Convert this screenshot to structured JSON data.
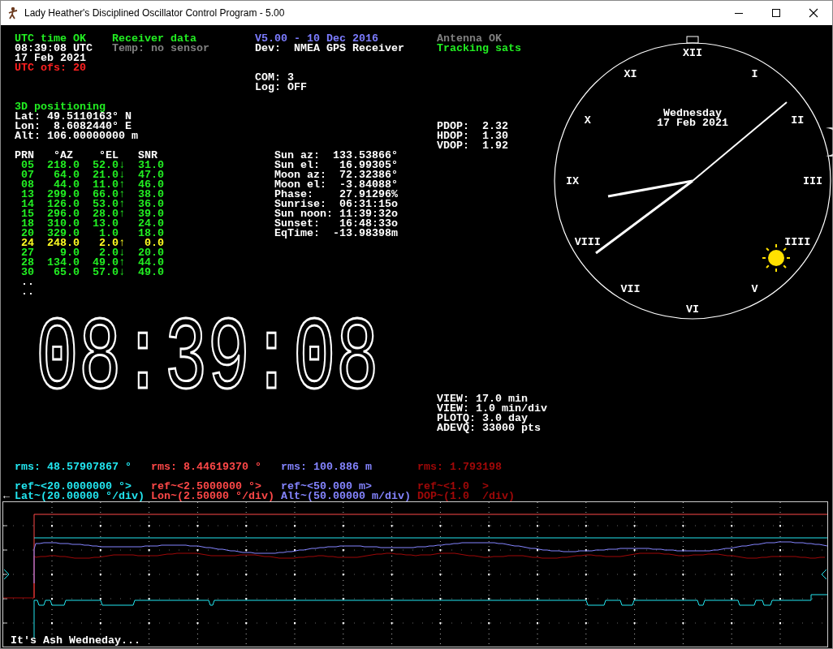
{
  "window": {
    "title": "Lady Heather's Disciplined Oscillator Control Program - 5.00"
  },
  "status": {
    "time_status": "UTC time OK",
    "time": "08:39:08 UTC",
    "date": "17 Feb 2021",
    "utc_offset": "UTC ofs: 20"
  },
  "receiver": {
    "heading": "Receiver data",
    "temperature": "Temp: no sensor"
  },
  "device": {
    "version": "V5.00 - 10 Dec 2016",
    "device": "Dev:  NMEA GPS Receiver",
    "com": "COM: 3",
    "log": "Log: OFF"
  },
  "antenna": {
    "antenna": "Antenna OK",
    "tracking": "Tracking sats"
  },
  "position": {
    "mode": "3D positioning",
    "lines": [
      "Lat: 49.5110163° N",
      "Lon:  8.6082440° E",
      "Alt: 106.00000000 m"
    ]
  },
  "satellites": {
    "columns": [
      "PRN",
      "°AZ",
      "°EL",
      "SNR"
    ],
    "rows": [
      {
        "prn": "05",
        "az": "218.0",
        "el": "52.0",
        "trend": "↓",
        "snr": "31.0",
        "color": "#22ee22"
      },
      {
        "prn": "07",
        "az": "64.0",
        "el": "21.0",
        "trend": "↓",
        "snr": "47.0",
        "color": "#22ee22"
      },
      {
        "prn": "08",
        "az": "44.0",
        "el": "11.0",
        "trend": "↑",
        "snr": "46.0",
        "color": "#22ee22"
      },
      {
        "prn": "13",
        "az": "299.0",
        "el": "66.0",
        "trend": "↑",
        "snr": "38.0",
        "color": "#22ee22"
      },
      {
        "prn": "14",
        "az": "126.0",
        "el": "53.0",
        "trend": "↑",
        "snr": "36.0",
        "color": "#22ee22"
      },
      {
        "prn": "15",
        "az": "296.0",
        "el": "28.0",
        "trend": "↑",
        "snr": "39.0",
        "color": "#22ee22"
      },
      {
        "prn": "18",
        "az": "310.0",
        "el": "13.0",
        "snr": "24.0",
        "color": "#22ee22"
      },
      {
        "prn": "20",
        "az": "329.0",
        "el": "1.0",
        "snr": "18.0",
        "color": "#22ee22"
      },
      {
        "prn": "24",
        "az": "248.0",
        "el": "2.0",
        "trend": "↑",
        "snr": "0.0",
        "color": "#ffff22"
      },
      {
        "prn": "27",
        "az": "9.0",
        "el": "2.0",
        "trend": "↓",
        "snr": "20.0",
        "color": "#22ee22"
      },
      {
        "prn": "28",
        "az": "134.0",
        "el": "49.0",
        "trend": "↑",
        "snr": "44.0",
        "color": "#22ee22"
      },
      {
        "prn": "30",
        "az": "65.0",
        "el": "57.0",
        "trend": "↓",
        "snr": "49.0",
        "color": "#22ee22"
      }
    ],
    "more": [
      "..",
      ".."
    ]
  },
  "astro": [
    {
      "label": "Sun az:",
      "value": "133.53866°"
    },
    {
      "label": "Sun el:",
      "value": "16.99305°"
    },
    {
      "label": "Moon az:",
      "value": "72.32386°"
    },
    {
      "label": "Moon el:",
      "value": "-3.84088°"
    },
    {
      "label": "Phase:",
      "value": "27.91296%"
    },
    {
      "label": "Sunrise:",
      "value": "06:31:15o"
    },
    {
      "label": "Sun noon:",
      "value": "11:39:32o"
    },
    {
      "label": "Sunset:",
      "value": "16:48:33o"
    },
    {
      "label": "EqTime:",
      "value": "-13.98398m"
    }
  ],
  "dop": [
    "PDOP:  2.32",
    "HDOP:  1.30",
    "VDOP:  1.92"
  ],
  "digital_clock": "08:39:08",
  "analog_clock": {
    "day": "Wednesday",
    "date": "17 Feb 2021",
    "numerals": [
      "XII",
      "I",
      "II",
      "III",
      "IIII",
      "V",
      "VI",
      "VII",
      "VIII",
      "IX",
      "X",
      "XI"
    ]
  },
  "plot_info": [
    "VIEW: 17.0 min",
    "VIEW: 1.0 min/div",
    "PLOTQ: 3.0 day",
    "ADEVQ: 33000 pts"
  ],
  "plot": {
    "marker": "←",
    "series": [
      {
        "color": "#22e6f0",
        "rms": "rms: 48.57907867 °",
        "ref": "ref~<20.0000000 °>",
        "scale": "Lat~(20.00000 °/div)"
      },
      {
        "color": "#ff4848",
        "rms": "rms: 8.44619370 °",
        "ref": "ref~<2.5000000 °>",
        "scale": "Lon~(2.50000 °/div)"
      },
      {
        "color": "#8484ff",
        "rms": "rms: 100.886 m",
        "ref": "ref~<50.000 m>",
        "scale": "Alt~(50.00000 m/div)"
      },
      {
        "color": "#a00808",
        "rms": "rms: 1.793198",
        "ref": "ref~<1.0  >",
        "scale": "DOP~(1.0  /div)"
      }
    ],
    "message": "It's Ash Wedneday..."
  }
}
